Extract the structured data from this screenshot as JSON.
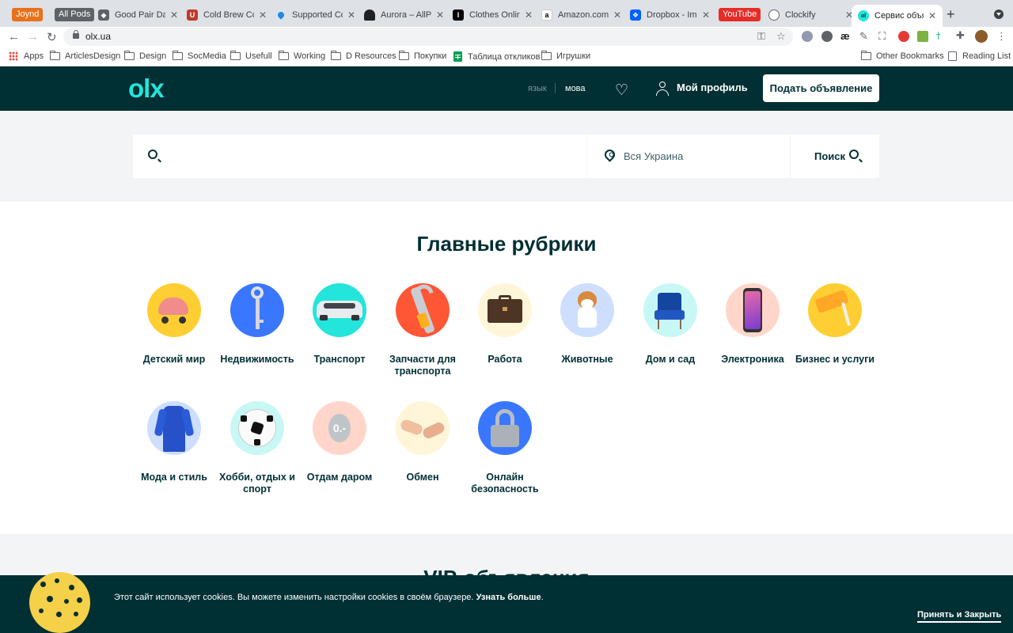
{
  "browser": {
    "tabs": [
      {
        "label": "Joynd",
        "kind": "pill",
        "color": "#e8711a"
      },
      {
        "label": "All Pods",
        "kind": "pill",
        "color": "#5f6368"
      },
      {
        "label": "Good Pair Days",
        "favicon": "car-icon"
      },
      {
        "label": "Cold Brew Coffee",
        "favicon": "magnet-icon"
      },
      {
        "label": "Supported Countries",
        "favicon": "drop-icon"
      },
      {
        "label": "Aurora – AllPods",
        "favicon": "ghost-icon"
      },
      {
        "label": "Clothes Online",
        "favicon": "i-icon"
      },
      {
        "label": "Amazon.com",
        "favicon": "amazon-icon"
      },
      {
        "label": "Dropbox - Images",
        "favicon": "dropbox-icon"
      },
      {
        "label": "YouTube",
        "kind": "pill",
        "color": "#e52d27"
      },
      {
        "label": "Clockify",
        "favicon": "clockify-icon"
      },
      {
        "label": "Сервис объявлений",
        "favicon": "olx-icon",
        "active": true
      }
    ],
    "url": "olx.ua",
    "bookmarks": [
      {
        "label": "Apps",
        "icon": "apps-grid-icon"
      },
      {
        "label": "ArticlesDesign",
        "icon": "folder-icon"
      },
      {
        "label": "Design",
        "icon": "folder-icon"
      },
      {
        "label": "SocMedia",
        "icon": "folder-icon"
      },
      {
        "label": "Usefull",
        "icon": "folder-icon"
      },
      {
        "label": "Working",
        "icon": "folder-icon"
      },
      {
        "label": "D Resources",
        "icon": "folder-icon"
      },
      {
        "label": "Покупки",
        "icon": "folder-icon"
      },
      {
        "label": "Таблица откликов",
        "icon": "sheets-icon"
      },
      {
        "label": "Игрушки",
        "icon": "folder-icon"
      },
      {
        "label": "Other Bookmarks",
        "icon": "folder-icon"
      },
      {
        "label": "Reading List",
        "icon": "reading-list-icon"
      }
    ]
  },
  "header": {
    "logo": "olx",
    "lang_ru": "язык",
    "lang_ua": "мова",
    "profile_label": "Мой профиль",
    "post_ad_label": "Подать объявление"
  },
  "search": {
    "query": "",
    "location": "Вся Украина",
    "button_label": "Поиск"
  },
  "categories": {
    "title": "Главные рубрики",
    "items": [
      {
        "label": "Детский мир",
        "color": "#ffce32"
      },
      {
        "label": "Недвижимость",
        "color": "#3a77ff"
      },
      {
        "label": "Транспорт",
        "color": "#23e5db"
      },
      {
        "label": "Запчасти для транспорта",
        "color": "#ff5636"
      },
      {
        "label": "Работа",
        "color": "#fff6d9"
      },
      {
        "label": "Животные",
        "color": "#cedeff"
      },
      {
        "label": "Дом и сад",
        "color": "#c8f8f6"
      },
      {
        "label": "Электроника",
        "color": "#ffd6c9"
      },
      {
        "label": "Бизнес и услуги",
        "color": "#ffce32"
      },
      {
        "label": "Мода и стиль",
        "color": "#cedeff"
      },
      {
        "label": "Хобби, отдых и спорт",
        "color": "#c8f8f6"
      },
      {
        "label": "Отдам даром",
        "color": "#ffd6c9"
      },
      {
        "label": "Обмен",
        "color": "#fff6d9"
      },
      {
        "label": "Онлайн безопасность",
        "color": "#3a77ff"
      }
    ]
  },
  "vip": {
    "title": "VIP-объявления"
  },
  "cookie": {
    "text": "Этот сайт использует cookies. Вы можете изменить настройки cookies в своём браузере.",
    "link": "Узнать больше",
    "accept": "Принять и Закрыть"
  }
}
